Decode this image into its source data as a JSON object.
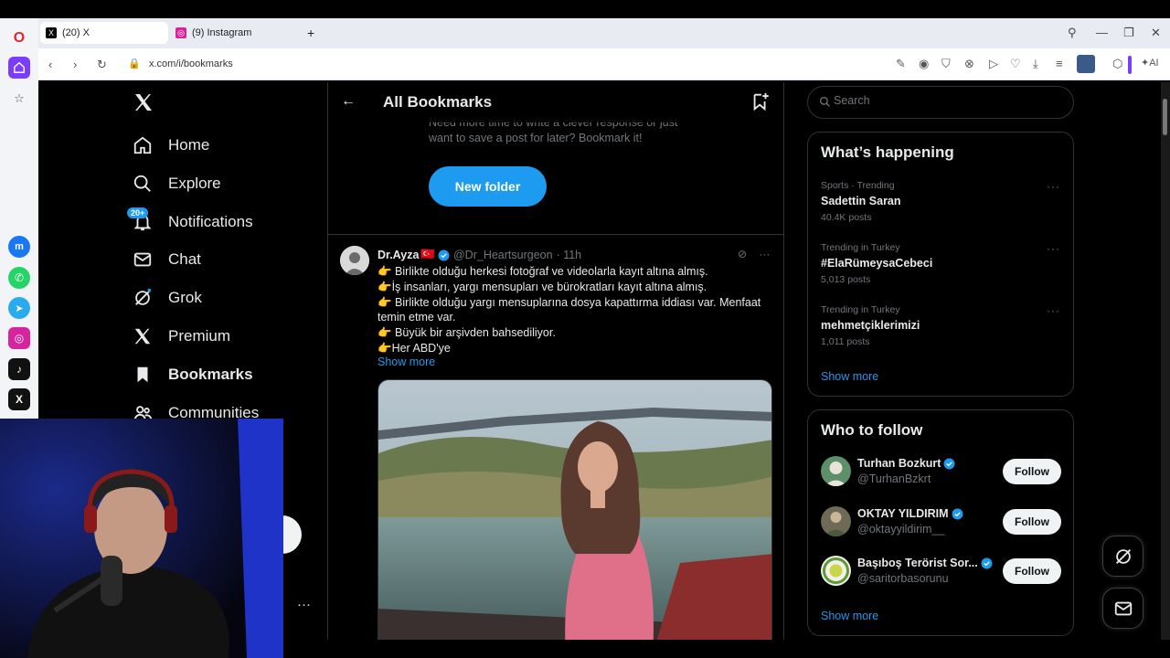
{
  "browser": {
    "tabs": [
      {
        "label": "(20) X",
        "icon": "x-icon",
        "active": true
      },
      {
        "label": "(9) Instagram",
        "icon": "instagram-icon",
        "active": false
      }
    ],
    "new_tab": "+",
    "url": "x.com/i/bookmarks",
    "ai_label": "AI"
  },
  "nav": {
    "items": [
      {
        "label": "Home",
        "icon": "home-icon"
      },
      {
        "label": "Explore",
        "icon": "search-icon"
      },
      {
        "label": "Notifications",
        "icon": "bell-icon"
      },
      {
        "label": "Chat",
        "icon": "mail-icon"
      },
      {
        "label": "Grok",
        "icon": "grok-icon"
      },
      {
        "label": "Premium",
        "icon": "x-icon"
      },
      {
        "label": "Bookmarks",
        "icon": "bookmark-icon"
      },
      {
        "label": "Communities",
        "icon": "people-icon"
      }
    ],
    "notifications_badge": "20+",
    "more": "···"
  },
  "header": {
    "title": "All Bookmarks"
  },
  "empty": {
    "text": "Need more time to write a clever response or just want to save a post for later? Bookmark it!",
    "button": "New folder"
  },
  "tweet": {
    "name": "Dr.Ayza",
    "flag": "🇹🇷",
    "handle": "@Dr_Heartsurgeon",
    "time": "· 11h",
    "lines": [
      "👉 Birlikte olduğu herkesi fotoğraf ve videolarla kayıt altına almış.",
      "👉İş insanları, yargı mensupları ve bürokratları kayıt altına almış.",
      "👉 Birlikte olduğu yargı mensuplarına dosya kapattırma iddiası var. Menfaat temin etme var.",
      "👉 Büyük bir arşivden bahsediliyor.",
      "👉Her ABD'ye"
    ],
    "show_more": "Show more"
  },
  "search": {
    "placeholder": "Search"
  },
  "happening": {
    "title": "What’s happening",
    "trends": [
      {
        "meta": "Sports · Trending",
        "name": "Sadettin Saran",
        "count": "40.4K posts"
      },
      {
        "meta": "Trending in Turkey",
        "name": "#ElaRümeysaCebeci",
        "count": "5,013 posts"
      },
      {
        "meta": "Trending in Turkey",
        "name": "mehmetçiklerimizi",
        "count": "1,011 posts"
      }
    ],
    "show_more": "Show more"
  },
  "who_to_follow": {
    "title": "Who to follow",
    "users": [
      {
        "name": "Turhan Bozkurt",
        "handle": "@TurhanBzkrt",
        "button": "Follow"
      },
      {
        "name": "OKTAY YILDIRIM",
        "handle": "@oktayyildirim__",
        "button": "Follow"
      },
      {
        "name": "Başıboş Terörist Sor...",
        "handle": "@saritorbasorunu",
        "button": "Follow"
      }
    ],
    "show_more": "Show more"
  },
  "colors": {
    "accent": "#1d9bf0",
    "background": "#000000",
    "border": "#2f3336",
    "muted": "#71767b"
  }
}
